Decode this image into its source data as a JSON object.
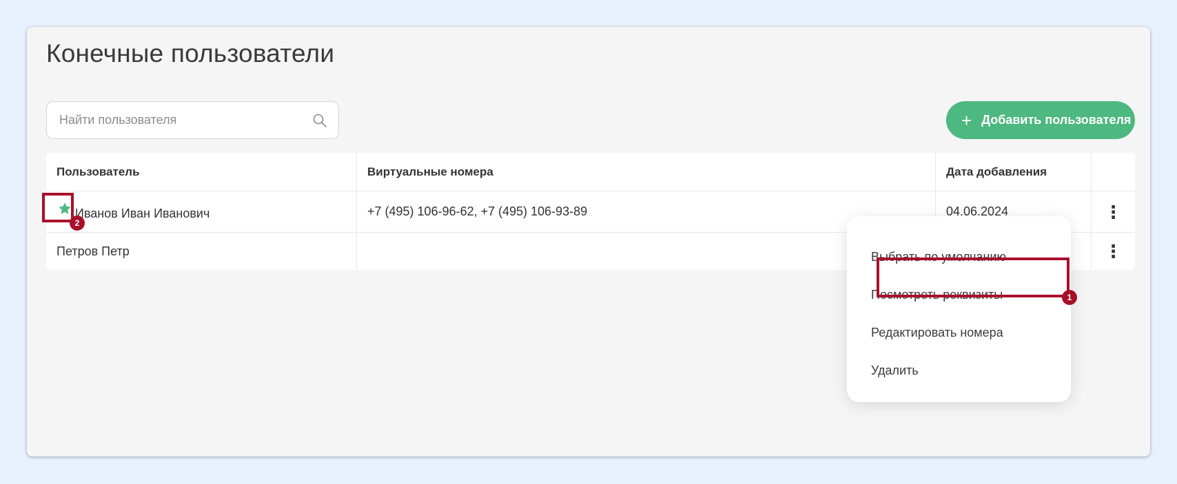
{
  "page": {
    "title": "Конечные пользователи"
  },
  "search": {
    "placeholder": "Найти пользователя",
    "icon": "search-icon"
  },
  "add_button": {
    "label": "Добавить пользователя",
    "icon": "plus-icon",
    "color": "#4db880"
  },
  "table": {
    "columns": [
      "Пользователь",
      "Виртуальные номера",
      "Дата добавления",
      ""
    ],
    "rows": [
      {
        "user": "Иванов Иван Иванович",
        "numbers": "+7 (495) 106-96-62, +7 (495) 106-93-89",
        "date": "04.06.2024",
        "is_default": true,
        "star_color": "#4db880"
      },
      {
        "user": "Петров Петр",
        "numbers": "",
        "date": "",
        "is_default": false
      }
    ]
  },
  "context_menu": {
    "items": [
      "Выбрать по умолчанию",
      "Посмотреть реквизиты",
      "Редактировать номера",
      "Удалить"
    ]
  },
  "annotations": [
    {
      "number": "1",
      "color": "#a8102a"
    },
    {
      "number": "2",
      "color": "#a8102a"
    }
  ]
}
